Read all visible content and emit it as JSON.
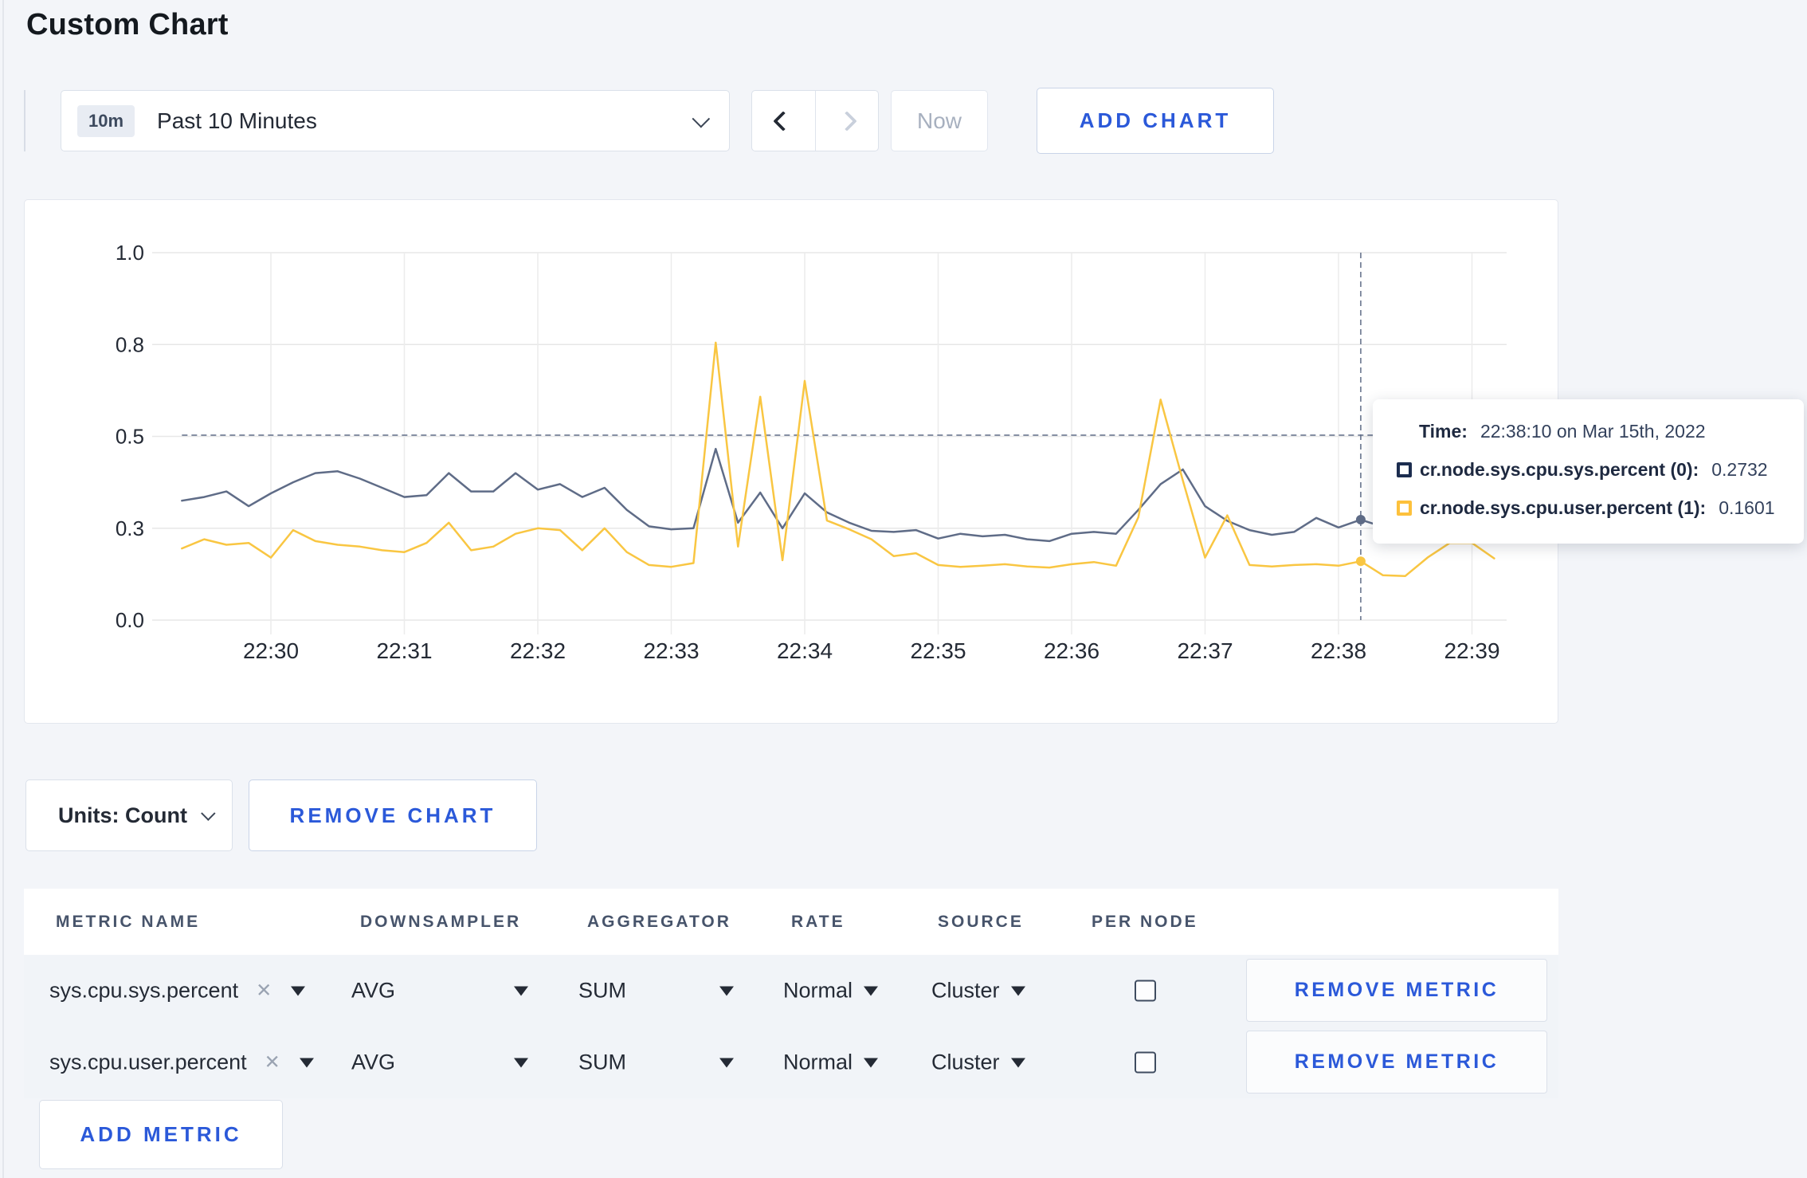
{
  "page": {
    "title": "Custom Chart"
  },
  "toolbar": {
    "range_badge": "10m",
    "range_label": "Past 10 Minutes",
    "now_label": "Now",
    "add_chart_label": "ADD CHART"
  },
  "chart_footer": {
    "units_label": "Units: Count",
    "remove_chart_label": "REMOVE CHART",
    "add_metric_label": "ADD METRIC"
  },
  "tooltip": {
    "time_label": "Time:",
    "time_value": "22:38:10 on Mar 15th, 2022",
    "rows": [
      {
        "label": "cr.node.sys.cpu.sys.percent (0):",
        "value": "0.2732",
        "color": "#1c2d4f"
      },
      {
        "label": "cr.node.sys.cpu.user.percent (1):",
        "value": "0.1601",
        "color": "#fdc13c"
      }
    ]
  },
  "metrics_table": {
    "headers": [
      "METRIC NAME",
      "DOWNSAMPLER",
      "AGGREGATOR",
      "RATE",
      "SOURCE",
      "PER NODE"
    ],
    "rows": [
      {
        "metric": "sys.cpu.sys.percent",
        "downsampler": "AVG",
        "aggregator": "SUM",
        "rate": "Normal",
        "source": "Cluster",
        "per_node_checked": false,
        "remove_label": "REMOVE METRIC"
      },
      {
        "metric": "sys.cpu.user.percent",
        "downsampler": "AVG",
        "aggregator": "SUM",
        "rate": "Normal",
        "source": "Cluster",
        "per_node_checked": false,
        "remove_label": "REMOVE METRIC"
      }
    ]
  },
  "chart_data": {
    "type": "line",
    "x_start": "22:29:20",
    "x_step_seconds": 10,
    "points_before_first_tick": 4,
    "points_per_tick": 6,
    "x_tick_labels": [
      "22:30",
      "22:31",
      "22:32",
      "22:33",
      "22:34",
      "22:35",
      "22:36",
      "22:37",
      "22:38",
      "22:39"
    ],
    "y_tick_labels": [
      "0.0",
      "0.3",
      "0.5",
      "0.8",
      "1.0"
    ],
    "y_tick_values": [
      0,
      0.25,
      0.5,
      0.75,
      1.0
    ],
    "y_domain": [
      0,
      1
    ],
    "grid": true,
    "legend_position": "tooltip-only",
    "series": [
      {
        "name": "cr.node.sys.cpu.sys.percent (0)",
        "color": "#5f6c87",
        "values": [
          0.325,
          0.335,
          0.35,
          0.31,
          0.345,
          0.375,
          0.4,
          0.405,
          0.385,
          0.36,
          0.335,
          0.34,
          0.4,
          0.35,
          0.35,
          0.4,
          0.355,
          0.37,
          0.335,
          0.36,
          0.3,
          0.255,
          0.247,
          0.25,
          0.466,
          0.265,
          0.347,
          0.25,
          0.345,
          0.293,
          0.265,
          0.243,
          0.24,
          0.245,
          0.222,
          0.235,
          0.228,
          0.232,
          0.22,
          0.215,
          0.235,
          0.24,
          0.235,
          0.3,
          0.37,
          0.41,
          0.31,
          0.27,
          0.245,
          0.232,
          0.24,
          0.278,
          0.252,
          0.2732,
          0.254,
          0.26,
          0.27,
          0.28,
          0.285,
          0.28
        ]
      },
      {
        "name": "cr.node.sys.cpu.user.percent (1)",
        "color": "#f9c642",
        "values": [
          0.195,
          0.22,
          0.205,
          0.21,
          0.17,
          0.245,
          0.215,
          0.205,
          0.2,
          0.19,
          0.185,
          0.21,
          0.265,
          0.19,
          0.2,
          0.235,
          0.25,
          0.245,
          0.19,
          0.25,
          0.185,
          0.15,
          0.145,
          0.155,
          0.755,
          0.2,
          0.608,
          0.163,
          0.651,
          0.271,
          0.247,
          0.22,
          0.174,
          0.182,
          0.15,
          0.145,
          0.148,
          0.152,
          0.146,
          0.143,
          0.152,
          0.158,
          0.148,
          0.28,
          0.6,
          0.38,
          0.17,
          0.285,
          0.15,
          0.146,
          0.15,
          0.152,
          0.148,
          0.1601,
          0.122,
          0.12,
          0.17,
          0.21,
          0.21,
          0.168
        ]
      }
    ],
    "crosshair": {
      "time_label": "22:38:10",
      "point_index": 53,
      "h_line_value": 0.5033
    }
  }
}
